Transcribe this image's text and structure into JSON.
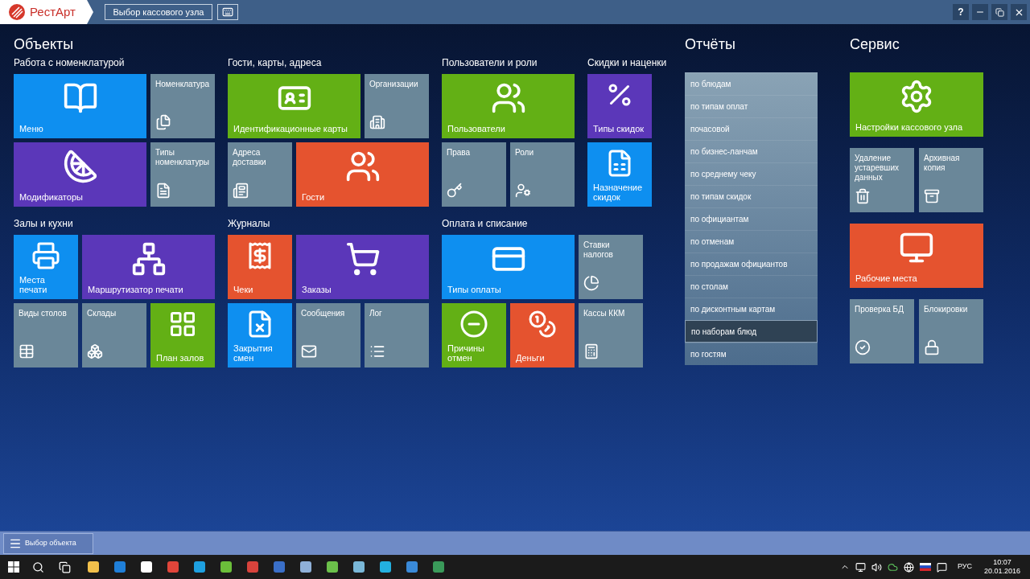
{
  "app": {
    "logo": "РестАрт",
    "node_button": "Выбор кассового узла",
    "help": "?"
  },
  "objects": {
    "title": "Объекты",
    "rows": [
      [
        {
          "title": "Работа с номенклатурой",
          "tiles": [
            {
              "label": "Меню",
              "color": "#0e8ff0",
              "wide": true,
              "kind": "feature"
            },
            {
              "label": "Номенклатура",
              "color": "#6a8799",
              "wide": false,
              "kind": "plain"
            },
            {
              "label": "Модификаторы",
              "color": "#5b37b9",
              "wide": true,
              "kind": "feature"
            },
            {
              "label": "Типы номенклатуры",
              "color": "#6a8799",
              "wide": false,
              "kind": "plain"
            }
          ]
        },
        {
          "title": "Гости, карты, адреса",
          "tiles": [
            {
              "label": "Идентификационные карты",
              "color": "#63b015",
              "wide": true,
              "kind": "feature"
            },
            {
              "label": "Организации",
              "color": "#6a8799",
              "wide": false,
              "kind": "plain"
            },
            {
              "label": "Адреса доставки",
              "color": "#6a8799",
              "wide": false,
              "kind": "plain"
            },
            {
              "label": "Гости",
              "color": "#e5532f",
              "wide": true,
              "kind": "feature"
            }
          ]
        },
        {
          "title": "Пользователи и роли",
          "tiles": [
            {
              "label": "Пользователи",
              "color": "#63b015",
              "wide": true,
              "kind": "feature"
            },
            {
              "label": "Права",
              "color": "#6a8799",
              "wide": false,
              "kind": "plain"
            },
            {
              "label": "Роли",
              "color": "#6a8799",
              "wide": false,
              "kind": "plain"
            }
          ]
        },
        {
          "title": "Скидки и наценки",
          "tiles": [
            {
              "label": "Типы скидок",
              "color": "#5b37b9",
              "wide": false,
              "kind": "feature"
            },
            {
              "label": "Назначение скидок",
              "color": "#0e8ff0",
              "wide": false,
              "kind": "feature"
            }
          ]
        }
      ],
      [
        {
          "title": "Залы и кухни",
          "tiles": [
            {
              "label": "Места печати",
              "color": "#0e8ff0",
              "wide": false,
              "kind": "feature"
            },
            {
              "label": "Маршрутизатор печати",
              "color": "#5b37b9",
              "wide": true,
              "kind": "feature"
            },
            {
              "label": "Виды столов",
              "color": "#6a8799",
              "wide": false,
              "kind": "plain"
            },
            {
              "label": "Склады",
              "color": "#6a8799",
              "wide": false,
              "kind": "plain"
            },
            {
              "label": "План залов",
              "color": "#63b015",
              "wide": false,
              "kind": "feature"
            }
          ]
        },
        {
          "title": "Журналы",
          "tiles": [
            {
              "label": "Чеки",
              "color": "#e5532f",
              "wide": false,
              "kind": "feature"
            },
            {
              "label": "Заказы",
              "color": "#5b37b9",
              "wide": true,
              "kind": "feature"
            },
            {
              "label": "Закрытия смен",
              "color": "#0e8ff0",
              "wide": false,
              "kind": "feature"
            },
            {
              "label": "Сообщения",
              "color": "#6a8799",
              "wide": false,
              "kind": "plain"
            },
            {
              "label": "Лог",
              "color": "#6a8799",
              "wide": false,
              "kind": "plain"
            }
          ]
        },
        {
          "title": "Оплата и списание",
          "tiles": [
            {
              "label": "Типы оплаты",
              "color": "#0e8ff0",
              "wide": true,
              "kind": "feature"
            },
            {
              "label": "Ставки налогов",
              "color": "#6a8799",
              "wide": false,
              "kind": "plain"
            },
            {
              "label": "Причины отмен",
              "color": "#63b015",
              "wide": false,
              "kind": "feature"
            },
            {
              "label": "Деньги",
              "color": "#e5532f",
              "wide": false,
              "kind": "feature"
            },
            {
              "label": "Кассы ККМ",
              "color": "#6a8799",
              "wide": false,
              "kind": "plain"
            }
          ]
        }
      ]
    ]
  },
  "reports": {
    "title": "Отчёты",
    "items": [
      {
        "label": "по блюдам",
        "selected": false
      },
      {
        "label": "по типам оплат",
        "selected": false
      },
      {
        "label": "почасовой",
        "selected": false
      },
      {
        "label": "по бизнес-ланчам",
        "selected": false
      },
      {
        "label": "по среднему чеку",
        "selected": false
      },
      {
        "label": "по типам скидок",
        "selected": false
      },
      {
        "label": "по официантам",
        "selected": false
      },
      {
        "label": "по отменам",
        "selected": false
      },
      {
        "label": "по продажам официантов",
        "selected": false
      },
      {
        "label": "по столам",
        "selected": false
      },
      {
        "label": "по дисконтным картам",
        "selected": false
      },
      {
        "label": "по наборам блюд",
        "selected": true
      },
      {
        "label": "по гостям",
        "selected": false
      }
    ]
  },
  "service": {
    "title": "Сервис",
    "rows": [
      [
        {
          "label": "Настройки кассового узла",
          "color": "#63b015",
          "wide": true,
          "kind": "feature"
        }
      ],
      [
        {
          "label": "Удаление устаревших данных",
          "color": "#6a8799",
          "wide": false,
          "kind": "plain"
        },
        {
          "label": "Архивная копия",
          "color": "#6a8799",
          "wide": false,
          "kind": "plain"
        }
      ],
      [
        {
          "label": "Рабочие места",
          "color": "#e5532f",
          "wide": true,
          "kind": "feature"
        }
      ],
      [
        {
          "label": "Проверка БД",
          "color": "#6a8799",
          "wide": false,
          "kind": "plain"
        },
        {
          "label": "Блокировки",
          "color": "#6a8799",
          "wide": false,
          "kind": "plain"
        }
      ]
    ]
  },
  "app_bar": {
    "object_button": "Выбор объекта"
  },
  "taskbar": {
    "language": "РУС",
    "time": "10:07",
    "date": "20.01.2016"
  }
}
